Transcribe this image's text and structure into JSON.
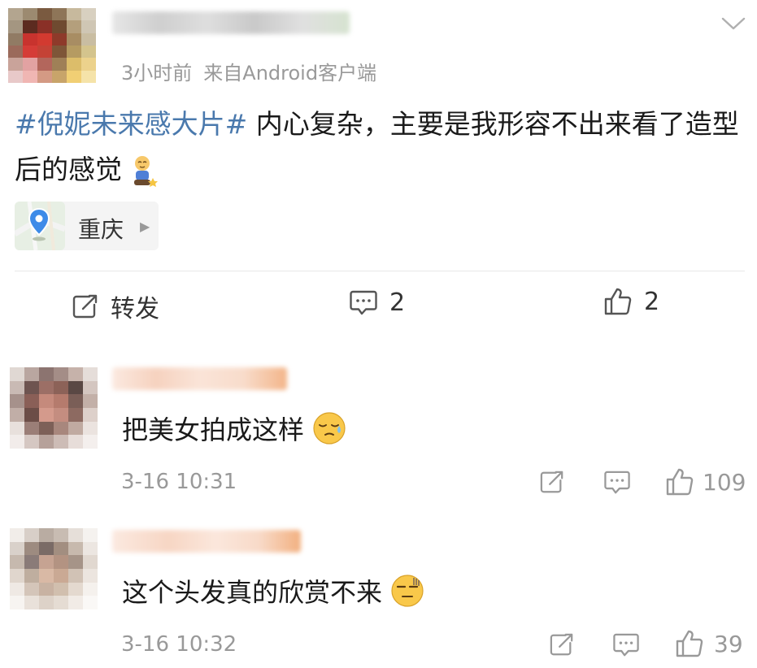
{
  "post": {
    "meta": {
      "time": "3小时前",
      "source": "来自Android客户端"
    },
    "topic": "#倪妮未来感大片#",
    "text": " 内心复杂，主要是我形容不出来看了造型后的感觉",
    "location": "重庆",
    "actions": {
      "repost_label": "转发",
      "comment_count": "2",
      "like_count": "2"
    }
  },
  "comments": [
    {
      "text": "把美女拍成这样",
      "time": "3-16 10:31",
      "like_count": "109"
    },
    {
      "text": "这个头发真的欣赏不来",
      "time": "3-16 10:32",
      "like_count": "39"
    }
  ],
  "colors": {
    "topic": "#4a79ad",
    "muted": "#999999",
    "text": "#1a1a1a"
  }
}
